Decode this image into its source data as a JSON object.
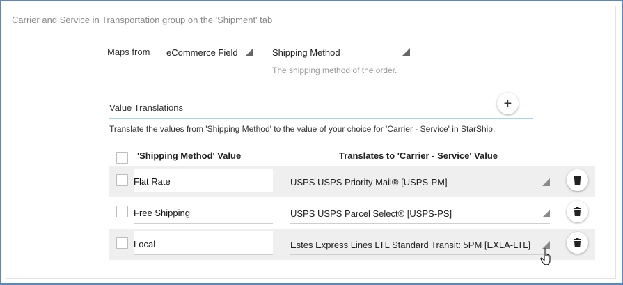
{
  "section": {
    "title": "Carrier and Service in Transportation group on the 'Shipment' tab"
  },
  "maps": {
    "label": "Maps from",
    "source_select": "eCommerce Field",
    "field_select": "Shipping Method",
    "helper": "The shipping method of the order."
  },
  "value_translations": {
    "title": "Value Translations",
    "add_icon": "plus-icon",
    "instructions": "Translate the values from 'Shipping Method' to the value of your choice for 'Carrier - Service' in StarShip.",
    "col_source": "'Shipping Method' Value",
    "col_target": "Translates to 'Carrier - Service' Value",
    "rows": [
      {
        "value": "Flat Rate",
        "translation": "USPS USPS Priority Mail® [USPS-PM]"
      },
      {
        "value": "Free Shipping",
        "translation": "USPS USPS Parcel Select® [USPS-PS]"
      },
      {
        "value": "Local",
        "translation": "Estes Express Lines LTL Standard Transit: 5PM [EXLA-LTL]"
      }
    ]
  },
  "colors": {
    "frame_border": "#5b86c5",
    "underline_accent": "#a9d1f0",
    "row_shade": "#efefef"
  }
}
